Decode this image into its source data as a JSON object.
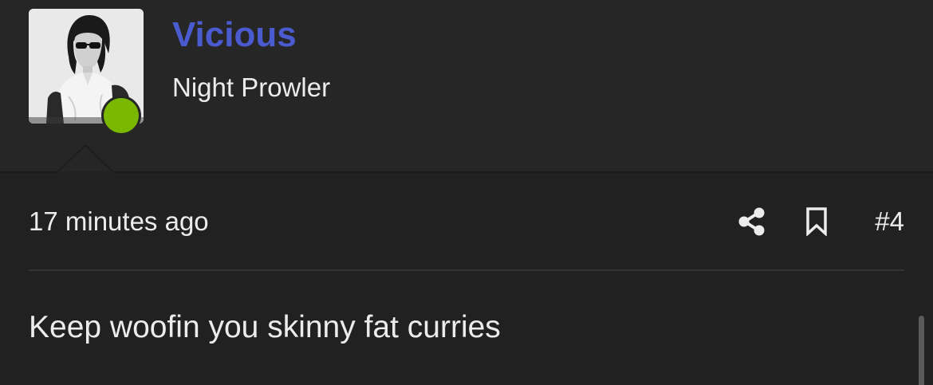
{
  "user": {
    "name": "Vicious",
    "title": "Night Prowler",
    "status": "online",
    "status_color": "#7ab800",
    "name_color": "#4a5bd0"
  },
  "post": {
    "timestamp": "17 minutes ago",
    "number": "#4",
    "message": "Keep woofin you skinny fat curries"
  },
  "actions": {
    "share_icon": "share-icon",
    "bookmark_icon": "bookmark-icon"
  }
}
